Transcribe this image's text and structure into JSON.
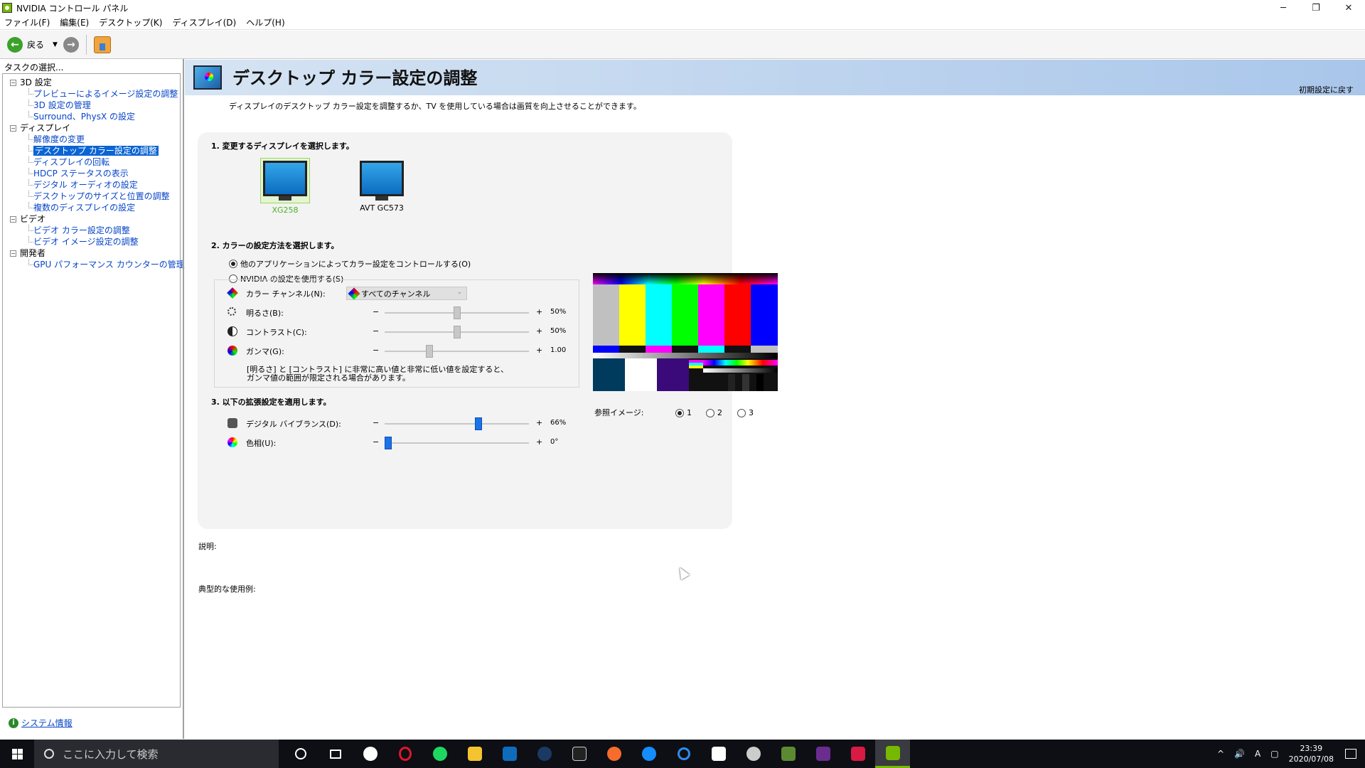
{
  "window": {
    "title": "NVIDIA コントロール パネル",
    "controls": {
      "minimize": "─",
      "maximize": "❐",
      "close": "✕"
    }
  },
  "menu": [
    "ファイル(F)",
    "編集(E)",
    "デスクトップ(K)",
    "ディスプレイ(D)",
    "ヘルプ(H)"
  ],
  "toolbar": {
    "back_label": "戻る",
    "back_icon": "←",
    "forward_icon": "→",
    "dropdown": "▼"
  },
  "left_panel": {
    "label": "タスクの選択...",
    "tree": [
      {
        "type": "cat",
        "toggle": "−",
        "label": "3D 設定"
      },
      {
        "type": "child",
        "label": "プレビューによるイメージ設定の調整"
      },
      {
        "type": "child",
        "label": "3D 設定の管理"
      },
      {
        "type": "child",
        "label": "Surround、PhysX の設定"
      },
      {
        "type": "cat",
        "toggle": "−",
        "label": "ディスプレイ"
      },
      {
        "type": "child",
        "label": "解像度の変更"
      },
      {
        "type": "child",
        "label": "デスクトップ カラー設定の調整",
        "selected": true
      },
      {
        "type": "child",
        "label": "ディスプレイの回転"
      },
      {
        "type": "child",
        "label": "HDCP ステータスの表示"
      },
      {
        "type": "child",
        "label": "デジタル オーディオの設定"
      },
      {
        "type": "child",
        "label": "デスクトップのサイズと位置の調整"
      },
      {
        "type": "child",
        "label": "複数のディスプレイの設定"
      },
      {
        "type": "cat",
        "toggle": "−",
        "label": "ビデオ"
      },
      {
        "type": "child",
        "label": "ビデオ カラー設定の調整"
      },
      {
        "type": "child",
        "label": "ビデオ イメージ設定の調整"
      },
      {
        "type": "cat",
        "toggle": "−",
        "label": "開発者"
      },
      {
        "type": "child",
        "label": "GPU パフォーマンス カウンターの管理"
      }
    ],
    "system_info": "システム情報",
    "system_info_icon": "i"
  },
  "header": {
    "title": "デスクトップ カラー設定の調整",
    "restore_defaults": "初期設定に戻す"
  },
  "description": "ディスプレイのデスクトップ カラー設定を調整するか、TV を使用している場合は画質を向上させることができます。",
  "step1": {
    "title": "1. 変更するディスプレイを選択します。",
    "displays": [
      {
        "name": "XG258",
        "selected": true
      },
      {
        "name": "AVT GC573",
        "selected": false
      }
    ]
  },
  "step2": {
    "title": "2. カラーの設定方法を選択します。",
    "option_other": "他のアプリケーションによってカラー設定をコントロールする(O)",
    "option_nvidia": "NVIDIA の設定を使用する(S)",
    "channel_label": "カラー チャンネル(N):",
    "channel_value": "すべてのチャンネル",
    "sliders": [
      {
        "label": "明るさ(B):",
        "value_text": "50%",
        "level": 0.5
      },
      {
        "label": "コントラスト(C):",
        "value_text": "50%",
        "level": 0.5
      },
      {
        "label": "ガンマ(G):",
        "value_text": "1.00",
        "level": 0.3
      }
    ],
    "minus": "−",
    "plus": "+",
    "note": "[明るさ] と [コントラスト] に非常に高い値と非常に低い値を設定すると、ガンマ値の範囲が限定される場合があります。"
  },
  "step3": {
    "title": "3. 以下の拡張設定を適用します。",
    "sliders": [
      {
        "label": "デジタル バイブランス(D):",
        "value_text": "66%",
        "level": 0.66
      },
      {
        "label": "色相(U):",
        "value_text": "0°",
        "level": 0.0
      }
    ]
  },
  "reference": {
    "label": "参照イメージ:",
    "options": [
      "1",
      "2",
      "3"
    ],
    "selected": "1"
  },
  "sections": {
    "description_label": "説明:",
    "usage_label": "典型的な使用例:"
  },
  "taskbar": {
    "search_placeholder": "ここに入力して検索",
    "time": "23:39",
    "date": "2020/07/08",
    "ime": "A",
    "tray_chevron": "^"
  }
}
